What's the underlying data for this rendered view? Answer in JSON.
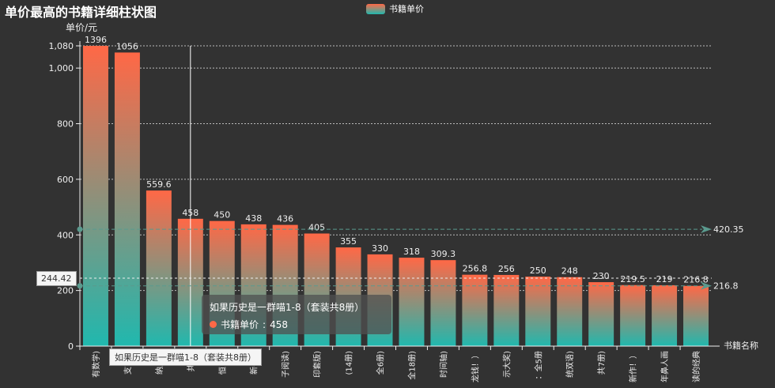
{
  "title": "单价最高的书籍详细柱状图",
  "legend_label": "书籍单价",
  "tooltip": {
    "title": "如果历史是一群喵1-8（套装共8册）",
    "series_label": "书籍单价",
    "value": "458"
  },
  "crosshair": {
    "x_label": "如果历史是一群喵1-8（套装共8册）",
    "y_label": "244.42"
  },
  "colors": {
    "background": "#323232",
    "gradient_top": "#ff6846",
    "gradient_bottom": "#20b8ae",
    "markline": "#5a9a8e"
  },
  "chart_data": {
    "type": "bar",
    "ylabel": "单价/元",
    "xlabel": "书籍名称",
    "ylim": [
      0,
      1080
    ],
    "y_ticks": [
      0,
      200,
      400,
      600,
      800,
      "1,000",
      "1,080"
    ],
    "categories": [
      "有数学)",
      "支审录",
      "纳户帐",
      "共8册",
      "恒出品",
      "新平装",
      "子阅读)",
      "印套版)",
      "(14册)",
      "全6册)",
      "全18册)",
      "时间轴)",
      "龙钱！）",
      "示大奖)",
      "：全5册",
      "统双语)",
      "共7册)",
      "新作！）",
      "年鼻人画",
      "读的经典"
    ],
    "values": [
      1396,
      1056,
      559.6,
      458,
      450,
      438,
      436,
      405,
      355,
      330,
      318,
      309.3,
      256.8,
      256,
      250,
      248,
      230,
      219.5,
      219,
      216.8
    ],
    "value_labels": [
      "1396",
      "1056",
      "559.6",
      "458",
      "450",
      "438",
      "436",
      "405",
      "355",
      "330",
      "318",
      "309.3",
      "256.8",
      "256",
      "250",
      "248",
      "230",
      "219.5",
      "219",
      "216.8"
    ],
    "mark_lines": [
      {
        "value": 420.35,
        "label": "420.35"
      },
      {
        "value": 216.8,
        "label": "216.8"
      }
    ],
    "grid": true,
    "legend_position": "top-center"
  }
}
